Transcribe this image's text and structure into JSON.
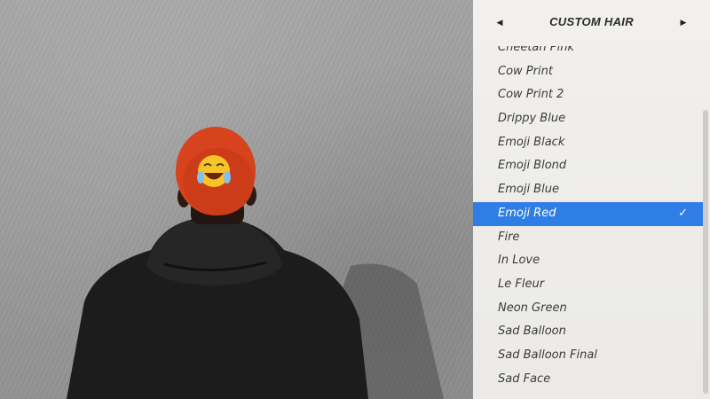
{
  "panel": {
    "title": "CUSTOM HAIR",
    "prev_arrow": "◀",
    "next_arrow": "▶",
    "check_glyph": "✓",
    "selected_color": "#2f7ee6",
    "items": [
      {
        "label": "Cheetah Pink",
        "selected": false
      },
      {
        "label": "Cow Print",
        "selected": false
      },
      {
        "label": "Cow Print 2",
        "selected": false
      },
      {
        "label": "Drippy Blue",
        "selected": false
      },
      {
        "label": "Emoji Black",
        "selected": false
      },
      {
        "label": "Emoji Blond",
        "selected": false
      },
      {
        "label": "Emoji Blue",
        "selected": false
      },
      {
        "label": "Emoji Red",
        "selected": true
      },
      {
        "label": "Fire",
        "selected": false
      },
      {
        "label": "In Love",
        "selected": false
      },
      {
        "label": "Le Fleur",
        "selected": false
      },
      {
        "label": "Neon Green",
        "selected": false
      },
      {
        "label": "Sad Balloon",
        "selected": false
      },
      {
        "label": "Sad Balloon Final",
        "selected": false
      },
      {
        "label": "Sad Face",
        "selected": false
      }
    ]
  },
  "icons": {
    "prev": "chevron-left-icon",
    "next": "chevron-right-icon",
    "check": "checkmark-icon",
    "emoji": "laughing-emoji-icon"
  }
}
